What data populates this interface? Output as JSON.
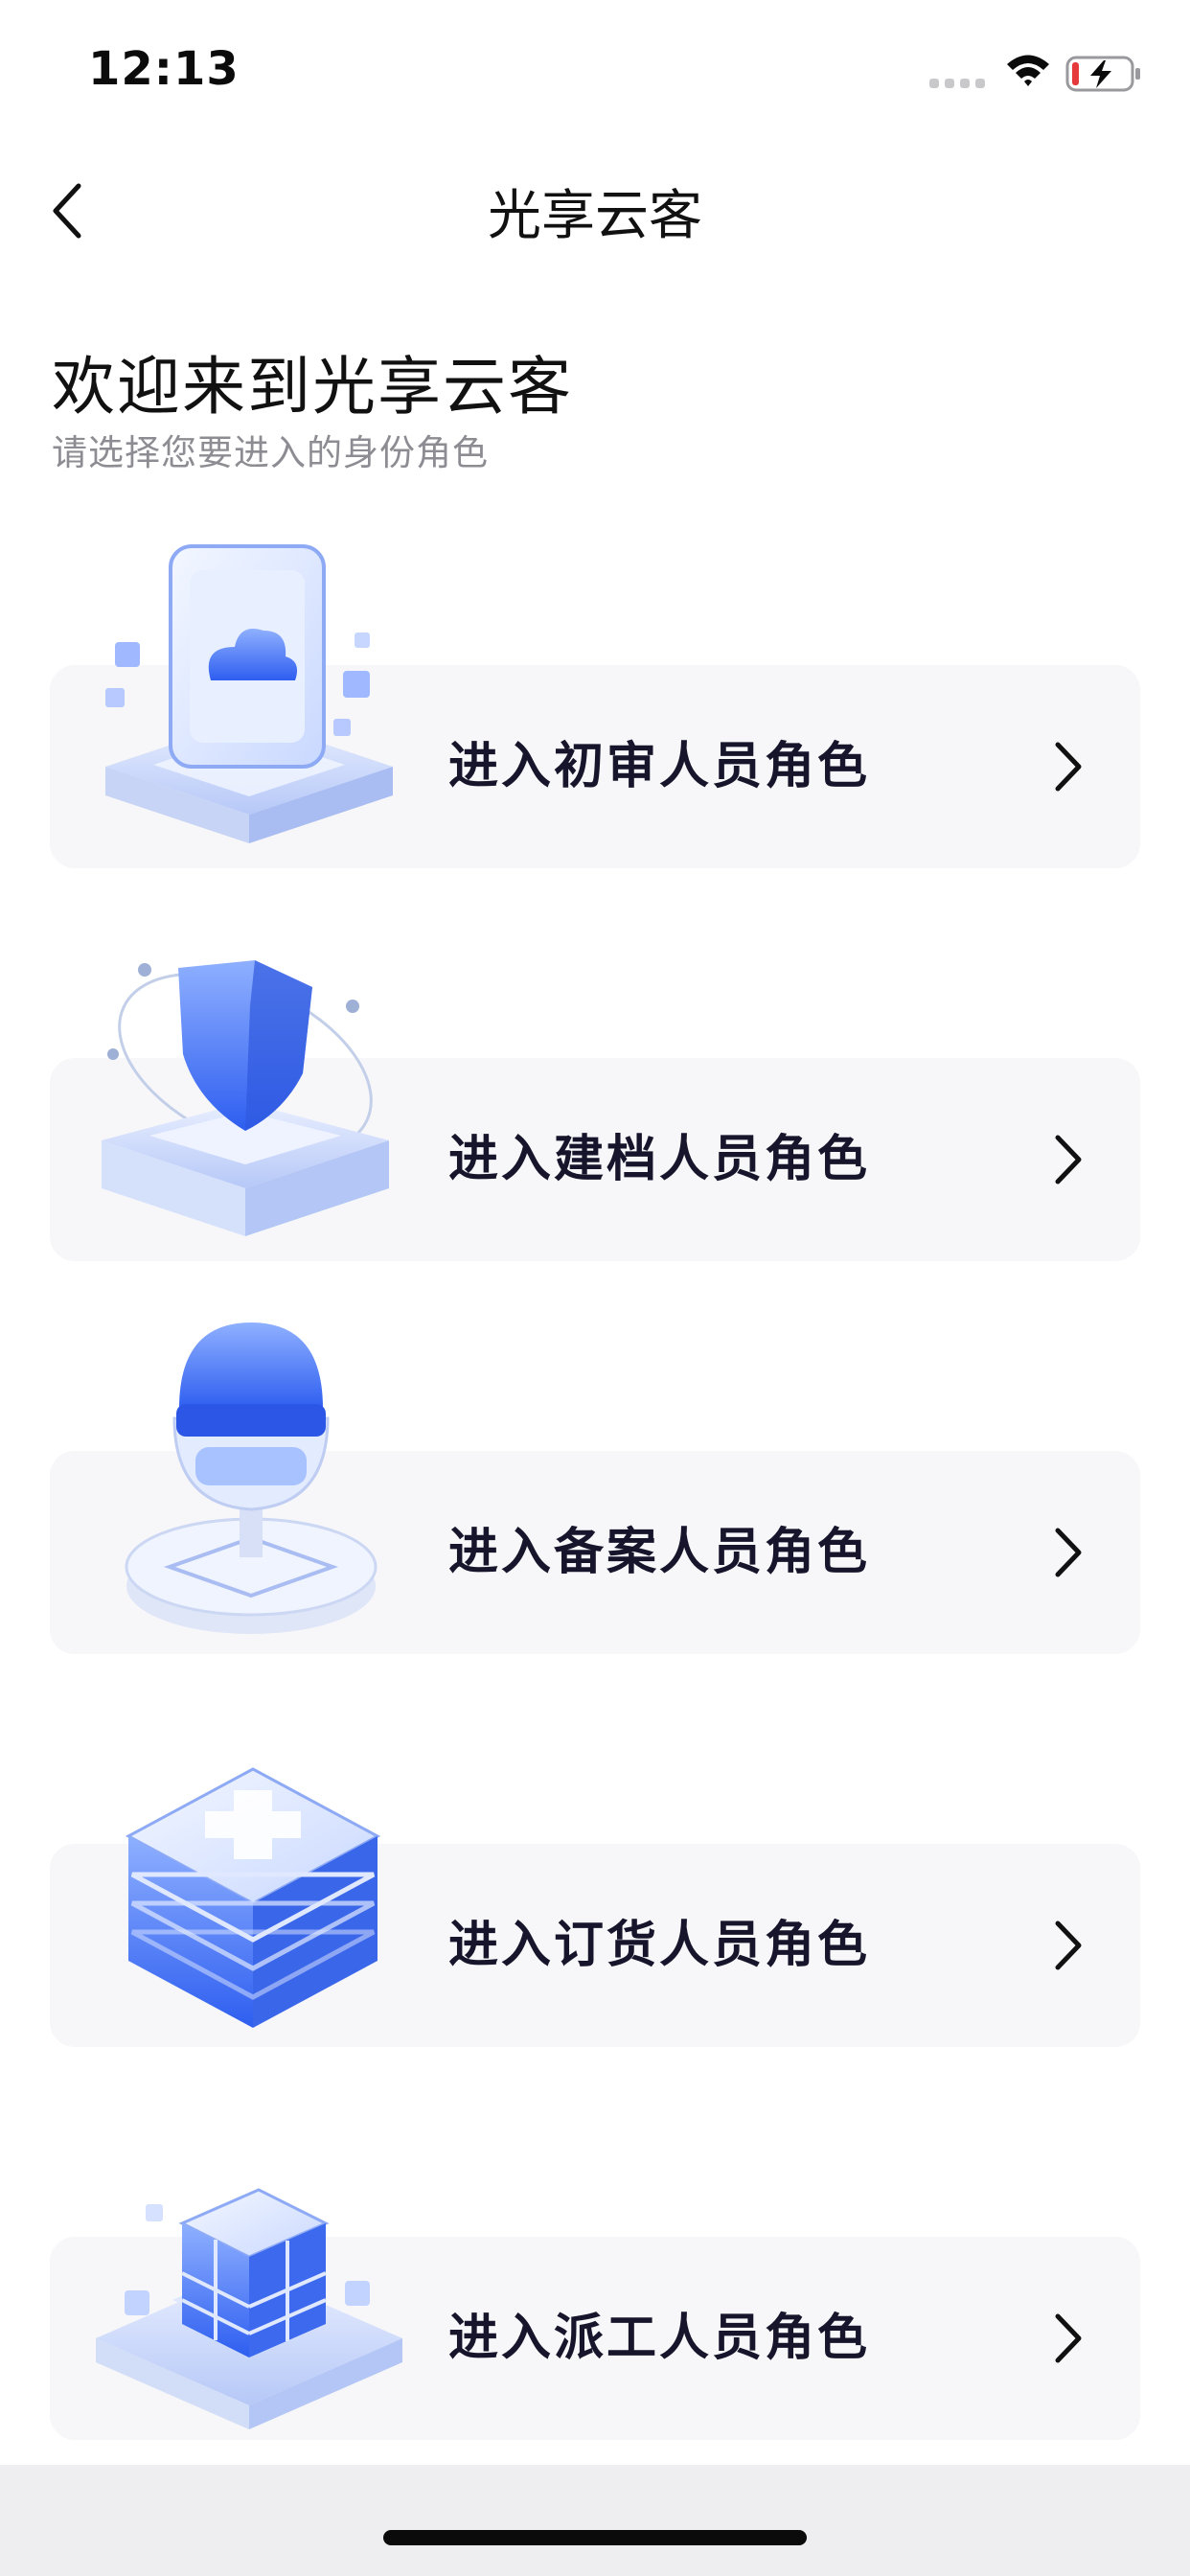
{
  "status_bar": {
    "time": "12:13",
    "signal_icon": "signal-dots-icon",
    "wifi_icon": "wifi-icon",
    "battery_icon": "battery-charging-icon",
    "battery_level": 0.12,
    "battery_low_color": "#e6393b"
  },
  "nav": {
    "title": "光享云客",
    "back_icon": "chevron-left-icon"
  },
  "header": {
    "welcome": "欢迎来到光享云客",
    "subtitle": "请选择您要进入的身份角色"
  },
  "roles": [
    {
      "label": "进入初审人员角色",
      "icon": "cloud-tablet-illustration"
    },
    {
      "label": "进入建档人员角色",
      "icon": "shield-illustration"
    },
    {
      "label": "进入备案人员角色",
      "icon": "microphone-illustration"
    },
    {
      "label": "进入订货人员角色",
      "icon": "medical-box-illustration"
    },
    {
      "label": "进入派工人员角色",
      "icon": "cube-illustration"
    }
  ],
  "colors": {
    "accent": "#3b6cf0",
    "card_bg": "#f7f7f9",
    "label": "#16152b",
    "subtitle": "#8c8c92"
  }
}
